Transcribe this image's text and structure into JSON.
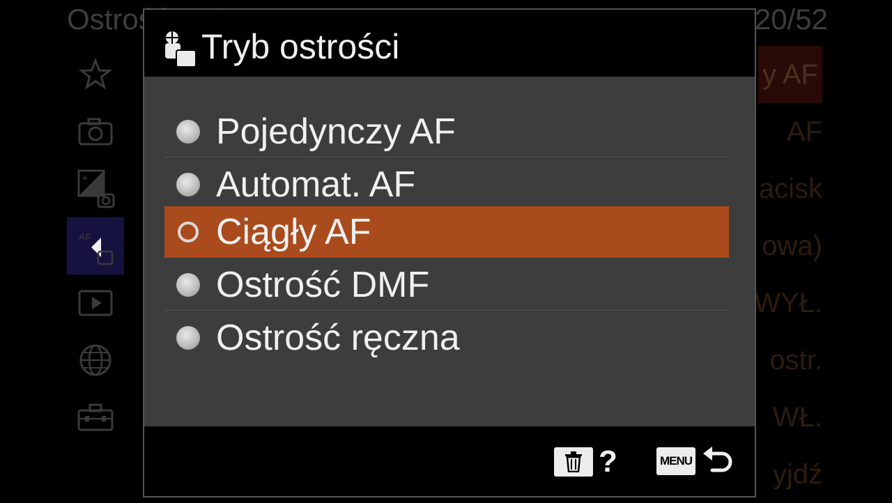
{
  "background_menu": {
    "title": "Ostrość AF/MF",
    "page_indicator": "20/52",
    "side_tabs": [
      {
        "icon": "star-icon"
      },
      {
        "icon": "camera-icon"
      },
      {
        "icon": "exposure-icon"
      },
      {
        "icon": "af-focus-icon",
        "active": true
      },
      {
        "icon": "playback-icon"
      },
      {
        "icon": "network-globe-icon"
      },
      {
        "icon": "toolbox-icon"
      }
    ],
    "right_values": [
      "y AF",
      "AF",
      "acisk",
      "owa)",
      "WYŁ.",
      "ostr.",
      "WŁ.",
      "yjdź"
    ]
  },
  "dialog": {
    "title": "Tryb ostrości",
    "title_icon": "focus-mode-icon",
    "options": [
      {
        "label": "Pojedynczy AF",
        "selected": false
      },
      {
        "label": "Automat. AF",
        "selected": false
      },
      {
        "label": "Ciągły AF",
        "selected": true
      },
      {
        "label": "Ostrość DMF",
        "selected": false
      },
      {
        "label": "Ostrość ręczna",
        "selected": false
      }
    ],
    "footer": {
      "help_label": "?",
      "menu_label": "MENU"
    }
  },
  "colors": {
    "highlight": "#aa4b1d",
    "body": "#3d3d3d",
    "text": "#f0f0f0"
  }
}
